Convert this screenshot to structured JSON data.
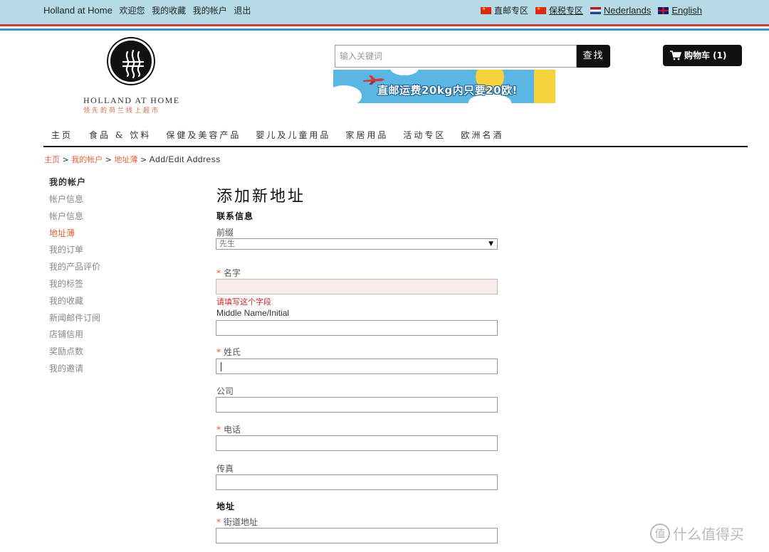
{
  "topbar": {
    "site_name": "Holland at Home",
    "welcome": "欢迎您",
    "wishlist": "我的收藏",
    "account": "我的帐户",
    "logout": "退出",
    "languages": [
      {
        "label": "直邮专区",
        "flag": "flag-cn-icon"
      },
      {
        "label": "保税专区",
        "flag": "flag-cn-icon"
      },
      {
        "label": "Nederlands",
        "flag": "flag-nl-icon"
      },
      {
        "label": "English",
        "flag": "flag-uk-icon"
      }
    ]
  },
  "brand": {
    "name": "HOLLAND AT HOME",
    "tagline": "领先的荷兰线上超市"
  },
  "search": {
    "placeholder": "输入关键词",
    "button": "查找"
  },
  "cart": {
    "label": "购物车 (1)"
  },
  "banner": {
    "text": "直邮运费20kg内只要20欧!"
  },
  "nav": {
    "items": [
      "主页",
      "食品 & 饮料",
      "保健及美容产品",
      "婴儿及儿童用品",
      "家居用品",
      "活动专区",
      "欧洲名酒"
    ]
  },
  "breadcrumb": {
    "home": "主页",
    "account": "我的帐户",
    "address_book": "地址薄",
    "current": "Add/Edit Address",
    "sep": ">"
  },
  "sidebar": {
    "title": "我的帐户",
    "items": [
      "帐户信息",
      "帐户信息",
      "地址薄",
      "我的订单",
      "我的产品评价",
      "我的标签",
      "我的收藏",
      "新闻邮件订阅",
      "店铺信用",
      "奖励点数",
      "我的邀请"
    ],
    "active_index": 2
  },
  "form": {
    "title": "添加新地址",
    "contact_section": "联系信息",
    "prefix_label": "前缀",
    "prefix_value": "先生",
    "firstname_label": "名字",
    "firstname_error": "请填写这个字段",
    "middlename_label": "Middle Name/Initial",
    "lastname_label": "姓氏",
    "company_label": "公司",
    "phone_label": "电话",
    "fax_label": "传真",
    "address_section": "地址",
    "street_label": "街道地址",
    "required_mark": "*"
  },
  "watermark": {
    "badge": "值",
    "text": "什么值得买"
  },
  "colors": {
    "topbar_bg": "#b4dbe6",
    "accent": "#e0643c",
    "error": "#c92727",
    "dark": "#111111"
  }
}
